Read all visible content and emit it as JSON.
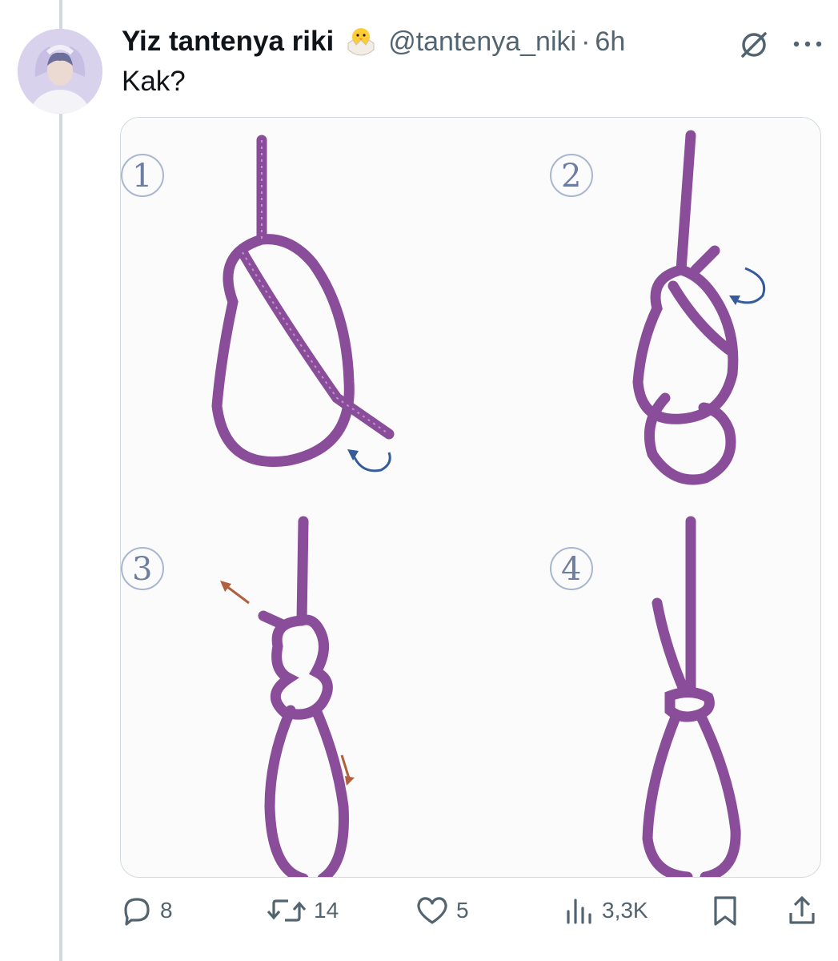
{
  "tweet": {
    "display_name": "Yiz tantenya riki",
    "emoji_icon": "hatching-chick-icon",
    "handle": "@tantenya_niki",
    "separator": "·",
    "time": "6h",
    "text": "Kak?"
  },
  "media": {
    "step_labels": [
      "1",
      "2",
      "3",
      "4"
    ],
    "rope_color": "#8a4d99",
    "arrow_color_blue": "#355b9a",
    "arrow_color_brown": "#b0603d"
  },
  "actions": {
    "replies": "8",
    "reposts": "14",
    "likes": "5",
    "views": "3,3K"
  },
  "colors": {
    "text_primary": "#0f1419",
    "text_secondary": "#536471",
    "thread_line": "#cfd9de"
  }
}
